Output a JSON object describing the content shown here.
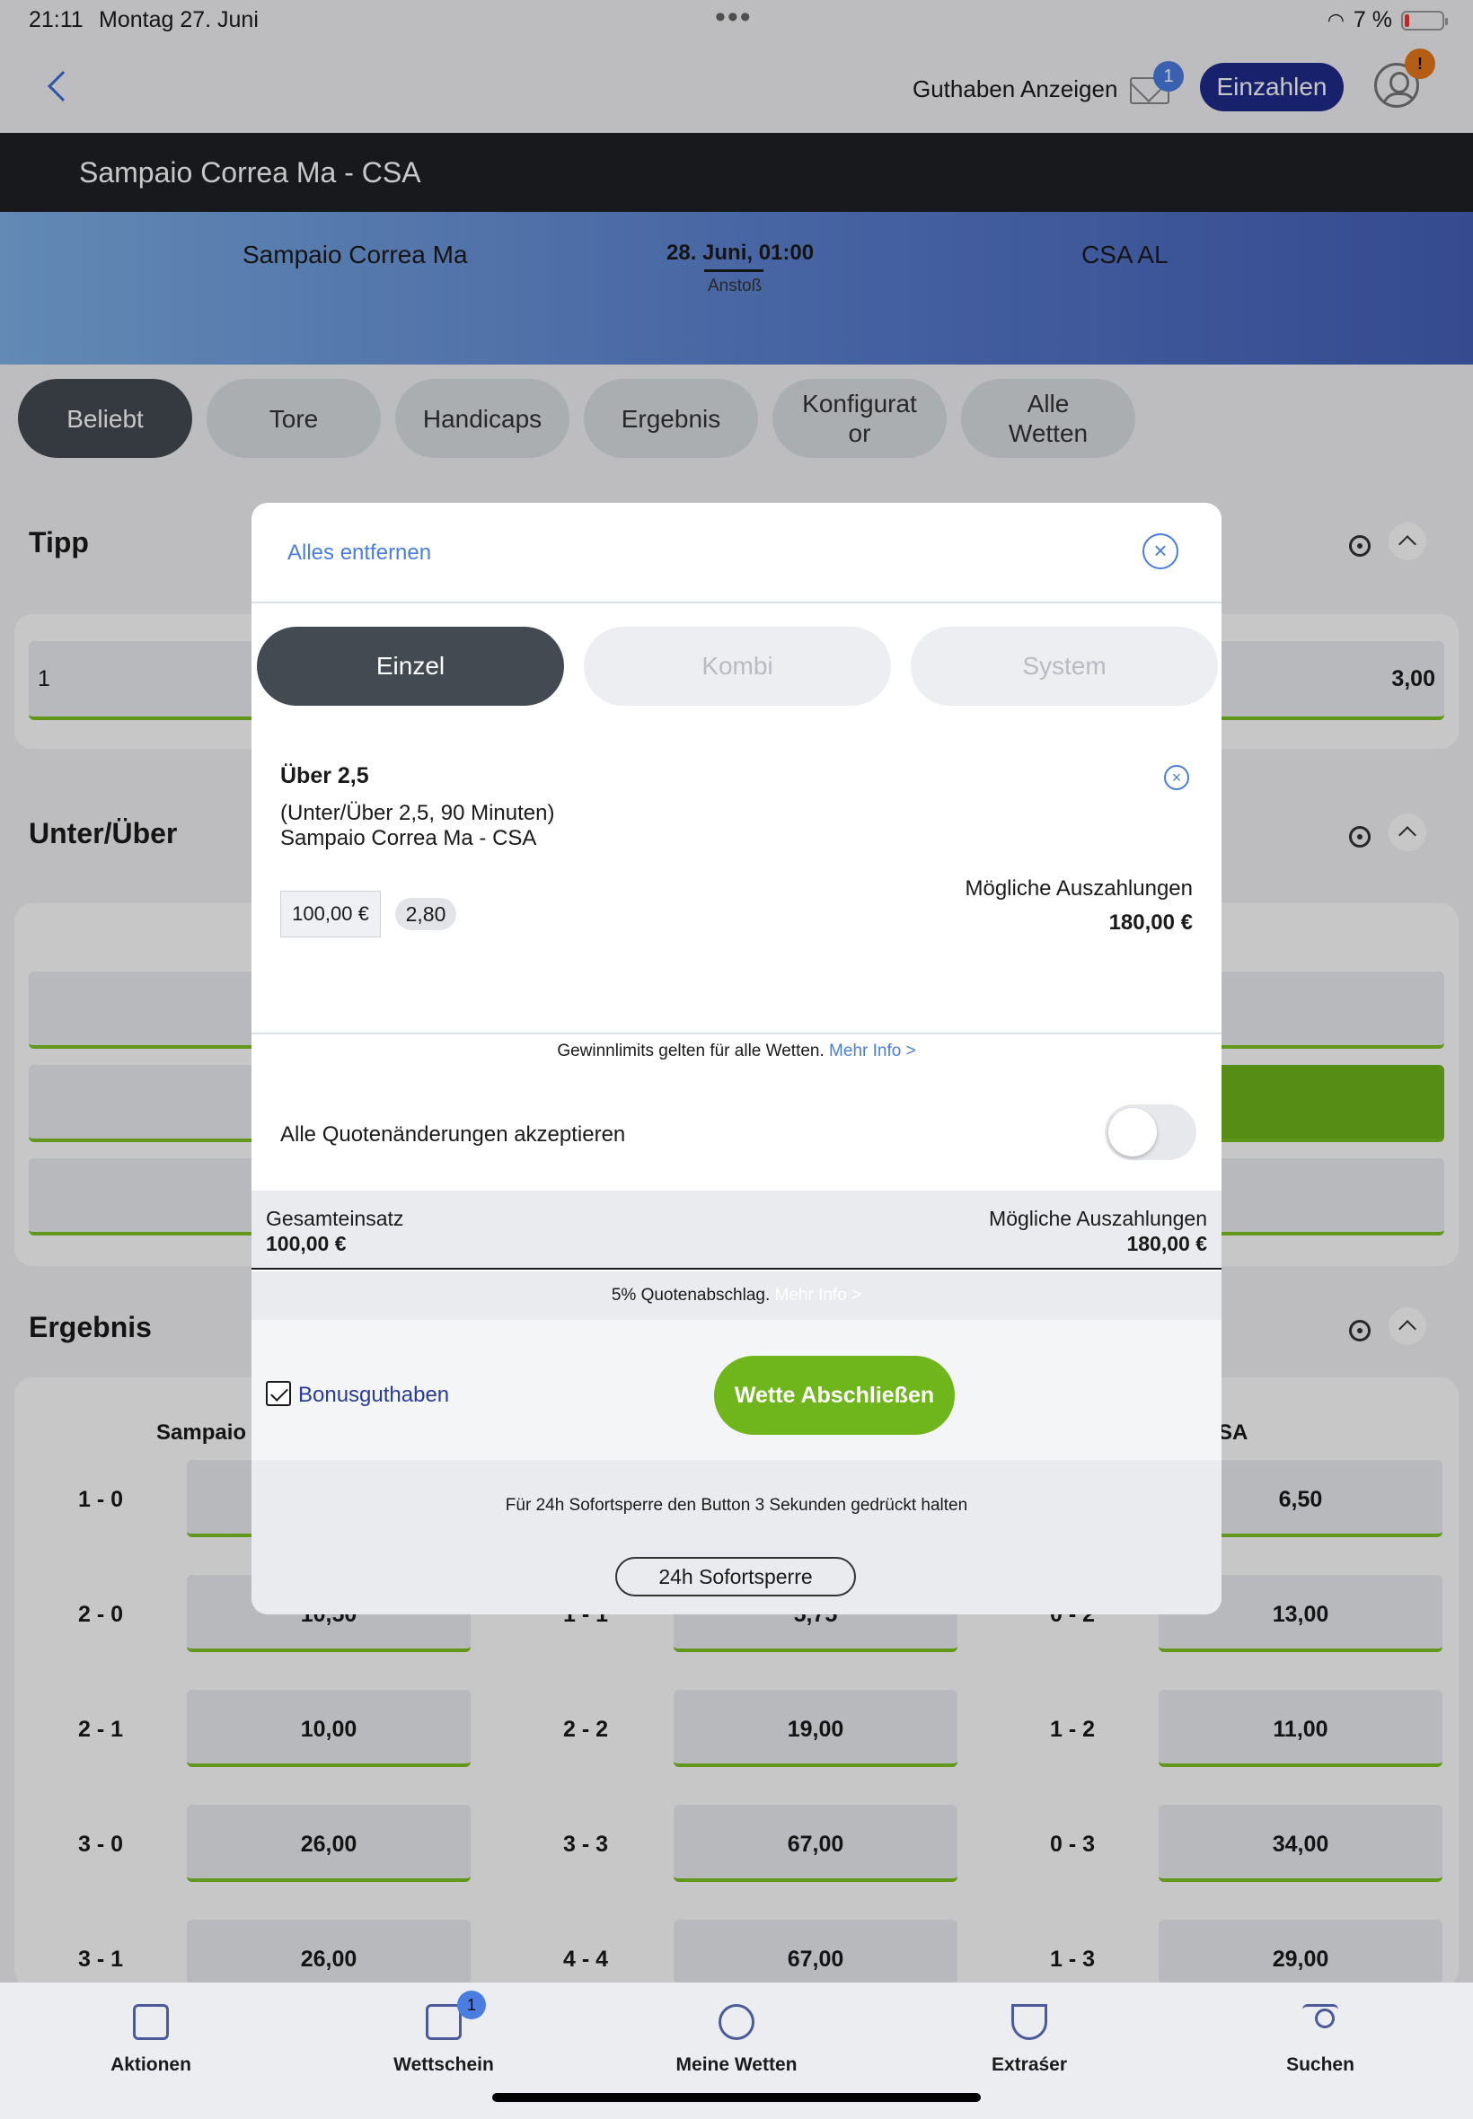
{
  "status": {
    "time": "21:11",
    "date": "Montag 27. Juni",
    "battery": "7 %"
  },
  "topnav": {
    "show_balance": "Guthaben Anzeigen",
    "mail_badge": "1",
    "deposit_label": "Einzahlen",
    "account_badge": "!"
  },
  "match": {
    "title": "Sampaio Correa Ma - CSA",
    "home": "Sampaio Correa Ma",
    "kickoff": "28. Juni, 01:00",
    "kickoff_label": "Anstoß",
    "away": "CSA AL"
  },
  "tabs": [
    {
      "label": "Beliebt"
    },
    {
      "label": "Tore"
    },
    {
      "label": "Handicaps"
    },
    {
      "label": "Ergebnis"
    },
    {
      "label": "Konfigurat or"
    },
    {
      "label": "Alle Wetten"
    }
  ],
  "sections": {
    "tipp": {
      "title": "Tipp",
      "left_label": "1",
      "right_value": "3,00"
    },
    "unter_ueber": {
      "title": "Unter/Über"
    },
    "ergebnis": {
      "title": "Ergebnis",
      "home_header": "Sampaio C",
      "away_header": "SA",
      "rows": [
        {
          "h": "1 - 0",
          "hv": "",
          "d": "",
          "dv": "",
          "a": "",
          "av": "6,50"
        },
        {
          "h": "2 - 0",
          "hv": "10,50",
          "d": "1 - 1",
          "dv": "5,75",
          "a": "0 - 2",
          "av": "13,00"
        },
        {
          "h": "2 - 1",
          "hv": "10,00",
          "d": "2 - 2",
          "dv": "19,00",
          "a": "1 - 2",
          "av": "11,00"
        },
        {
          "h": "3 - 0",
          "hv": "26,00",
          "d": "3 - 3",
          "dv": "67,00",
          "a": "0 - 3",
          "av": "34,00"
        },
        {
          "h": "3 - 1",
          "hv": "26,00",
          "d": "4 - 4",
          "dv": "67,00",
          "a": "1 - 3",
          "av": "29,00"
        }
      ]
    }
  },
  "betslip": {
    "remove_all": "Alles entfernen",
    "modes": [
      {
        "label": "Einzel"
      },
      {
        "label": "Kombi"
      },
      {
        "label": "System"
      }
    ],
    "selection": {
      "title": "Über 2,5",
      "market": "(Unter/Über 2,5, 90 Minuten)",
      "match": "Sampaio Correa Ma - CSA",
      "stake": "100,00 €",
      "odds": "2,80",
      "payout_label": "Mögliche Auszahlungen",
      "payout_value": "180,00 €"
    },
    "limits_text": "Gewinnlimits gelten für alle Wetten.",
    "more_info": "Mehr Info >",
    "accept_changes": "Alle Quotenänderungen akzeptieren",
    "total_stake_label": "Gesamteinsatz",
    "total_stake": "100,00 €",
    "total_payout_label": "Mögliche Auszahlungen",
    "total_payout": "180,00 €",
    "discount_text": "5% Quotenabschlag.",
    "bonus_label": "Bonusguthaben",
    "submit_label": "Wette Abschließen",
    "lock_hint": "Für 24h Sofortsperre den Button 3 Sekunden gedrückt halten",
    "lock_button": "24h Sofortsperre"
  },
  "bottomnav": [
    {
      "label": "Aktionen",
      "icon": "gift-icon"
    },
    {
      "label": "Wettschein",
      "icon": "betslip-icon",
      "badge": "1"
    },
    {
      "label": "Meine Wetten",
      "icon": "my-bets-icon"
    },
    {
      "label": "Extraśer",
      "icon": "trophy-icon"
    },
    {
      "label": "Suchen",
      "icon": "search-icon"
    }
  ]
}
